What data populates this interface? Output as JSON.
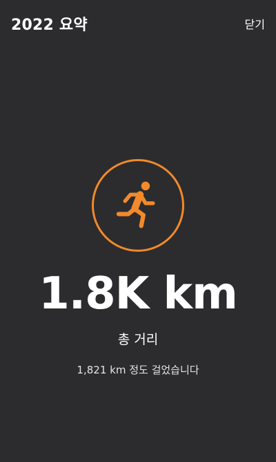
{
  "header": {
    "title": "2022 요약",
    "close_label": "닫기"
  },
  "summary": {
    "icon": "running-person-icon",
    "accent_color": "#f28a2b",
    "value": "1.8K km",
    "caption": "총 거리",
    "detail": "1,821 km 정도 걸었습니다"
  }
}
